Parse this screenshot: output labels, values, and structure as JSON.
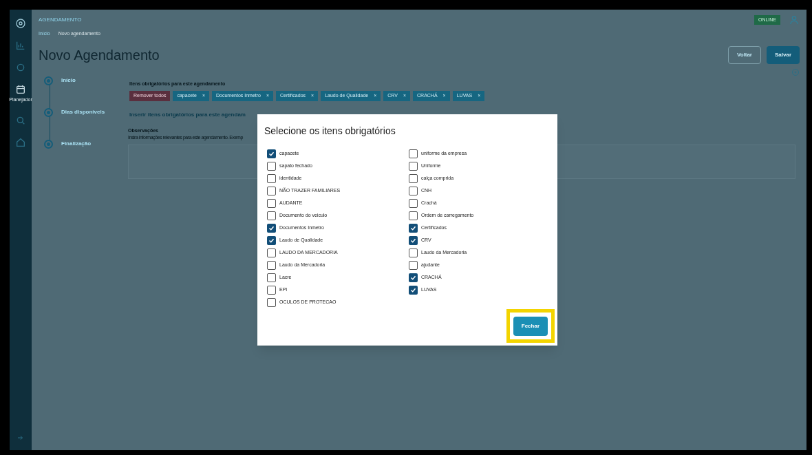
{
  "header": {
    "section": "AGENDAMENTO",
    "status": "ONLINE"
  },
  "sidebar": {
    "active_label": "Planejador"
  },
  "breadcrumb": [
    "Início",
    "Novo agendamento"
  ],
  "page_title": "Novo Agendamento",
  "actions": {
    "back": "Voltar",
    "save": "Salvar"
  },
  "steps": [
    {
      "label": "Início"
    },
    {
      "label": "Dias disponíveis"
    },
    {
      "label": "Finalização"
    }
  ],
  "required_items": {
    "title": "Itens obrigatórios para este agendamento",
    "remove_all": "Remover todos",
    "tags": [
      "capacete",
      "Documentos Inmetro",
      "Certificados",
      "Laudo de Qualidade",
      "CRV",
      "CRACHÁ",
      "LUVAS"
    ],
    "tag_close": "×",
    "insert_link": "Inserir itens obrigatórios para este agendam"
  },
  "observations": {
    "label": "Observações",
    "hint": "Insira informações relevantes para este agendamento. Exemp"
  },
  "modal": {
    "title": "Selecione os itens obrigatórios",
    "close": "Fechar",
    "columns": [
      [
        {
          "label": "capacete",
          "checked": true
        },
        {
          "label": "sapato fechado",
          "checked": false
        },
        {
          "label": "identidade",
          "checked": false
        },
        {
          "label": "NÃO TRAZER FAMILIARES",
          "checked": false
        },
        {
          "label": "AUDANTE",
          "checked": false
        },
        {
          "label": "Documento do veiculo",
          "checked": false
        },
        {
          "label": "Documentos Inmetro",
          "checked": true
        },
        {
          "label": "Laudo de Qualidade",
          "checked": true
        },
        {
          "label": "LAUDO DA MERCADORIA",
          "checked": false
        },
        {
          "label": "Laudo da Mercadoria",
          "checked": false
        },
        {
          "label": "Lacre",
          "checked": false
        },
        {
          "label": "EPI",
          "checked": false
        },
        {
          "label": "OCULOS DE PROTECAO",
          "checked": false
        }
      ],
      [
        {
          "label": "uniforme da empresa",
          "checked": false
        },
        {
          "label": "Uniforme",
          "checked": false
        },
        {
          "label": "calça comprida",
          "checked": false
        },
        {
          "label": "CNH",
          "checked": false
        },
        {
          "label": "Crachá",
          "checked": false
        },
        {
          "label": "Ordem de carregamento",
          "checked": false
        },
        {
          "label": "Certificados",
          "checked": true
        },
        {
          "label": "CRV",
          "checked": true
        },
        {
          "label": "Laudo da Mercadoria",
          "checked": false
        },
        {
          "label": "ajudante",
          "checked": false
        },
        {
          "label": "CRACHÁ",
          "checked": true
        },
        {
          "label": "LUVAS",
          "checked": true
        }
      ]
    ]
  }
}
